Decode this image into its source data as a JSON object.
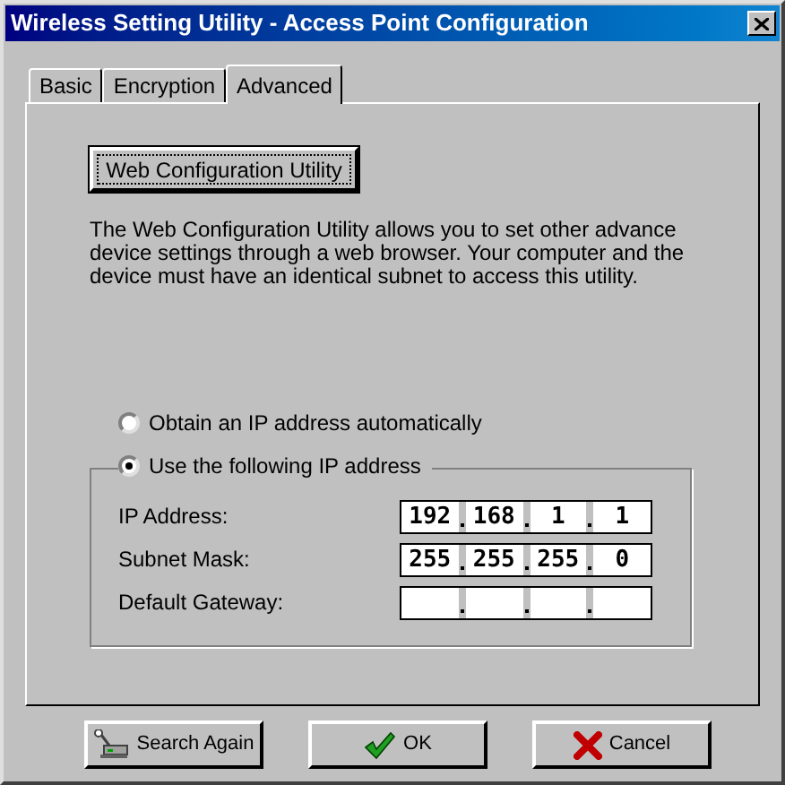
{
  "window": {
    "title": "Wireless Setting Utility - Access Point Configuration"
  },
  "tabs": [
    {
      "label": "Basic",
      "selected": false
    },
    {
      "label": "Encryption",
      "selected": false
    },
    {
      "label": "Advanced",
      "selected": true
    }
  ],
  "web_config_button": {
    "label": "Web Configuration Utility",
    "focused": true
  },
  "description": "The Web Configuration Utility allows you to set other advance device settings through a web browser. Your computer and the device must have an identical subnet to access this utility.",
  "ip_mode": [
    {
      "label": "Obtain an IP address automatically",
      "selected": false
    },
    {
      "label": "Use the following IP address",
      "selected": true
    }
  ],
  "ip_fields": [
    {
      "label": "IP Address:",
      "octets": [
        "192",
        "168",
        "1",
        "1"
      ]
    },
    {
      "label": "Subnet Mask:",
      "octets": [
        "255",
        "255",
        "255",
        "0"
      ]
    },
    {
      "label": "Default Gateway:"
    }
  ],
  "buttons": [
    {
      "kind": "search",
      "label": "Search Again"
    },
    {
      "kind": "ok",
      "label": "OK"
    },
    {
      "kind": "cancel",
      "label": "Cancel"
    }
  ]
}
